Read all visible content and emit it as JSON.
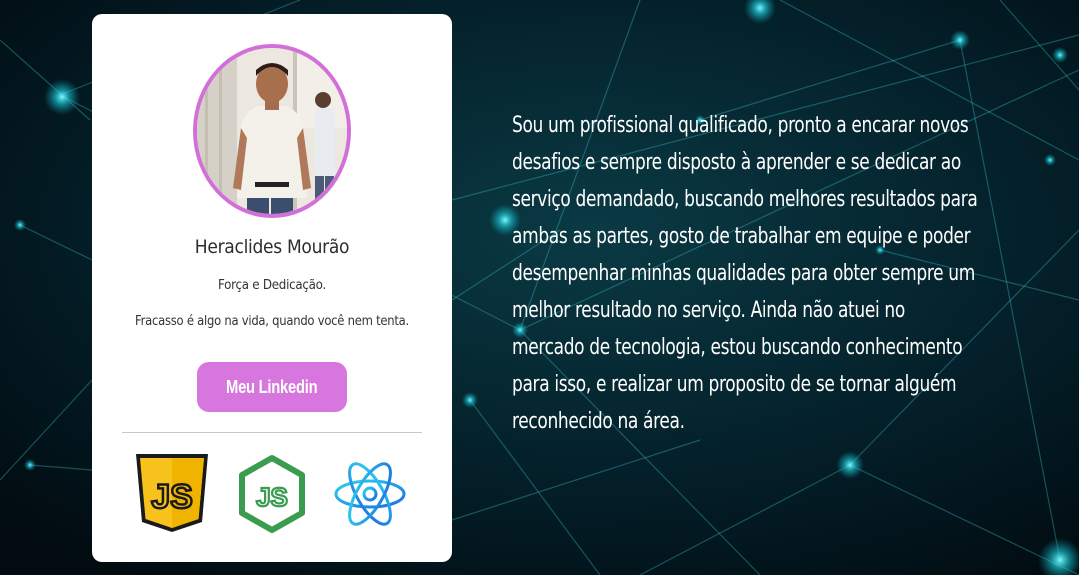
{
  "profile": {
    "name": "Heraclides Mourão",
    "tagline": "Força e Dedicação.",
    "quote": "Fracasso é algo na vida, quando você nem tenta.",
    "linkedin_button": "Meu Linkedin",
    "photo_icon": "profile-photo"
  },
  "skills": [
    {
      "name": "javascript",
      "icon": "javascript-icon",
      "text": "JS",
      "color": "#f7c21b"
    },
    {
      "name": "nodejs",
      "icon": "nodejs-icon",
      "text": "JS",
      "color": "#3a9c4f"
    },
    {
      "name": "react",
      "icon": "react-icon",
      "color": "#1e9be0"
    }
  ],
  "bio": {
    "text": "Sou um profissional qualificado, pronto a encarar novos desafios e sempre disposto à aprender e se dedicar ao serviço demandado, buscando melhores resultados para ambas as partes, gosto de trabalhar em equipe e poder desempenhar minhas qualidades para obter sempre um melhor resultado no serviço. Ainda não atuei no mercado de tecnologia, estou buscando conhecimento para isso, e realizar um proposito de se tornar alguém reconhecido na área."
  },
  "colors": {
    "accent": "#d776de",
    "avatar_border": "#d36fd8",
    "background": "#02141a"
  }
}
